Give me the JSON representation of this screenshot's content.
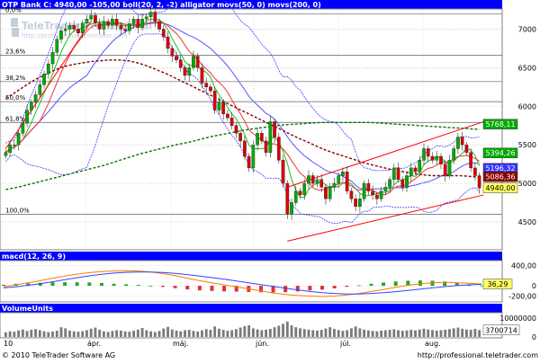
{
  "panels": {
    "main_title": "OTP Bank C: 4940,00 -105,00 boll(20, 2, -2) alligator movs(50, 0) movs(200, 0)",
    "macd_title": "macd(12, 26, 9)",
    "volume_title": "VolumeUnits"
  },
  "watermark": {
    "brand": "TeleTrader Professional",
    "url": "http://professional.teletrader.com"
  },
  "footer": {
    "copyright": "© 2010 TeleTrader Software AG",
    "url": "http://professional.teletrader.com"
  },
  "colors": {
    "title_bar": "#0000ff",
    "candle_up": "#00aa00",
    "candle_down": "#dd0000",
    "boll": "#5555ff",
    "ma50": "#880000",
    "ma200": "#007700",
    "channel": "#ff0000",
    "last_price": "#ffff66"
  },
  "chart_data": [
    {
      "type": "candlestick",
      "title": "OTP Bank C: 4940,00 -105,00 boll(20, 2, -2) alligator movs(50, 0) movs(200, 0)",
      "x_labels": [
        "10",
        "ápr.",
        "máj.",
        "jún.",
        "júl.",
        "aug."
      ],
      "y_ticks": [
        4500,
        5000,
        5500,
        6000,
        6500,
        7000
      ],
      "ylim": [
        4150,
        7250
      ],
      "fib_levels": [
        {
          "label": "0,0%",
          "value": 7200
        },
        {
          "label": "23,6%",
          "value": 6660
        },
        {
          "label": "38,2%",
          "value": 6320
        },
        {
          "label": "50,0%",
          "value": 6060
        },
        {
          "label": "61,8%",
          "value": 5790
        },
        {
          "label": "100,0%",
          "value": 4600
        }
      ],
      "price_boxes": [
        {
          "label": "5768,11",
          "value": 5768.11,
          "color": "#00aa00",
          "text": "#ffffff"
        },
        {
          "label": "5394,26",
          "value": 5394.26,
          "color": "#00aa00",
          "text": "#ffffff"
        },
        {
          "label": "5196,32",
          "value": 5196.32,
          "color": "#3333ff",
          "text": "#ffffff"
        },
        {
          "label": "5086,36",
          "value": 5086.36,
          "color": "#880000",
          "text": "#ffffff"
        },
        {
          "label": "4940,00",
          "value": 4940.0,
          "color": "#ffff66",
          "text": "#000000"
        }
      ],
      "closes": [
        5400,
        5500,
        5500,
        5650,
        5780,
        5950,
        6050,
        6150,
        6280,
        6420,
        6550,
        6700,
        6870,
        6980,
        7000,
        7050,
        7000,
        6950,
        7080,
        7130,
        7180,
        7080,
        7000,
        7100,
        7050,
        7130,
        7050,
        7000,
        6980,
        7070,
        7130,
        7020,
        7130,
        7160,
        7220,
        7100,
        7000,
        6900,
        6750,
        6650,
        6600,
        6500,
        6400,
        6500,
        6650,
        6500,
        6300,
        6250,
        6200,
        5950,
        6050,
        5900,
        5850,
        5750,
        5650,
        5550,
        5350,
        5200,
        5500,
        5650,
        5550,
        5400,
        5800,
        5600,
        5300,
        5000,
        4600,
        4750,
        4900,
        4850,
        5000,
        5100,
        5000,
        5050,
        4950,
        4800,
        4950,
        5000,
        5100,
        5150,
        4900,
        4800,
        4700,
        4800,
        5000,
        4900,
        4850,
        4800,
        4900,
        4950,
        5050,
        5200,
        5050,
        4950,
        5100,
        5200,
        5150,
        5300,
        5450,
        5350,
        5300,
        5350,
        5250,
        5100,
        5300,
        5450,
        5600,
        5500,
        5400,
        5200,
        5100,
        4940
      ],
      "ma50": [
        6100,
        6180,
        6260,
        6340,
        6400,
        6460,
        6510,
        6540,
        6560,
        6580,
        6590,
        6600,
        6600,
        6590,
        6560,
        6520,
        6470,
        6420,
        6360,
        6300,
        6240,
        6180,
        6120,
        6060,
        6000,
        5940,
        5880,
        5820,
        5760,
        5700,
        5640,
        5580,
        5530,
        5470,
        5420,
        5380,
        5340,
        5300,
        5260,
        5230,
        5200,
        5170,
        5150,
        5130,
        5110,
        5100,
        5100,
        5100,
        5100,
        5090,
        5080
      ],
      "ma200": [
        4920,
        4950,
        4990,
        5030,
        5070,
        5110,
        5150,
        5190,
        5230,
        5280,
        5330,
        5380,
        5420,
        5460,
        5500,
        5530,
        5570,
        5610,
        5640,
        5670,
        5700,
        5720,
        5740,
        5760,
        5770,
        5780,
        5790,
        5790,
        5790,
        5790,
        5790,
        5780,
        5770,
        5760,
        5750,
        5740,
        5730,
        5720,
        5710,
        5700
      ],
      "channel_lines": [
        {
          "from": [
            0,
            5450
          ],
          "to": [
            20,
            7100
          ]
        },
        {
          "from": [
            66,
            4950
          ],
          "to": [
            112,
            5800
          ]
        },
        {
          "from": [
            66,
            4250
          ],
          "to": [
            112,
            4850
          ]
        }
      ]
    },
    {
      "type": "line",
      "title": "macd(12, 26, 9)",
      "y_ticks": [
        -200,
        0,
        400
      ],
      "y_tick_labels": [
        "-200,00",
        "0",
        "400,00"
      ],
      "ylim": [
        -280,
        460
      ],
      "last_value": {
        "label": "36,29",
        "value": 36.29
      },
      "macd": [
        -20,
        20,
        60,
        100,
        150,
        190,
        230,
        260,
        280,
        290,
        295,
        290,
        270,
        240,
        200,
        150,
        100,
        60,
        20,
        -20,
        -60,
        -100,
        -140,
        -170,
        -190,
        -200,
        -210,
        -200,
        -180,
        -150,
        -110,
        -70,
        -30,
        10,
        40,
        60,
        70,
        60,
        50,
        36
      ],
      "signal": [
        -40,
        -20,
        10,
        40,
        80,
        120,
        160,
        195,
        225,
        250,
        265,
        272,
        270,
        262,
        245,
        220,
        190,
        160,
        130,
        95,
        60,
        25,
        -10,
        -45,
        -80,
        -110,
        -135,
        -150,
        -160,
        -160,
        -150,
        -135,
        -115,
        -90,
        -65,
        -40,
        -15,
        5,
        20,
        30
      ]
    },
    {
      "type": "bar",
      "title": "VolumeUnits",
      "y_ticks": [
        0,
        10000000
      ],
      "y_tick_labels": [
        "0",
        "10000000"
      ],
      "ylim": [
        0,
        12000000
      ],
      "last_value": {
        "label": "3700714",
        "value": 3700714
      },
      "values": [
        2500000,
        3000000,
        2800000,
        3500000,
        4000000,
        3200000,
        3800000,
        4200000,
        3600000,
        3000000,
        2600000,
        2900000,
        3300000,
        5200000,
        4600000,
        3400000,
        3000000,
        2800000,
        3100000,
        3600000,
        4400000,
        5000000,
        3800000,
        3000000,
        2700000,
        3200000,
        3600000,
        3400000,
        3000000,
        2800000,
        3300000,
        3900000,
        4800000,
        3600000,
        3000000,
        2600000,
        3200000,
        4500000,
        5400000,
        4000000,
        3400000,
        3000000,
        3600000,
        3800000,
        3200000,
        2900000,
        3500000,
        4200000,
        3800000,
        5600000,
        4400000,
        3800000,
        3300000,
        3600000,
        4200000,
        5000000,
        5800000,
        6200000,
        4600000,
        4000000,
        3600000,
        3900000,
        4300000,
        5200000,
        6000000,
        7000000,
        8200000,
        6200000,
        5200000,
        4600000,
        4200000,
        3900000,
        3600000,
        3400000,
        3800000,
        4500000,
        5200000,
        4300000,
        3700000,
        3300000,
        3600000,
        4600000,
        5600000,
        4600000,
        3900000,
        3500000,
        3200000,
        3000000,
        3400000,
        3600000,
        3800000,
        4100000,
        3600000,
        3300000,
        3500000,
        3800000,
        3500000,
        3900000,
        4400000,
        4000000,
        3700000,
        3400000,
        3600000,
        3900000,
        4200000,
        4600000,
        5000000,
        4400000,
        4000000,
        3800000,
        4300000,
        3700714
      ]
    }
  ]
}
